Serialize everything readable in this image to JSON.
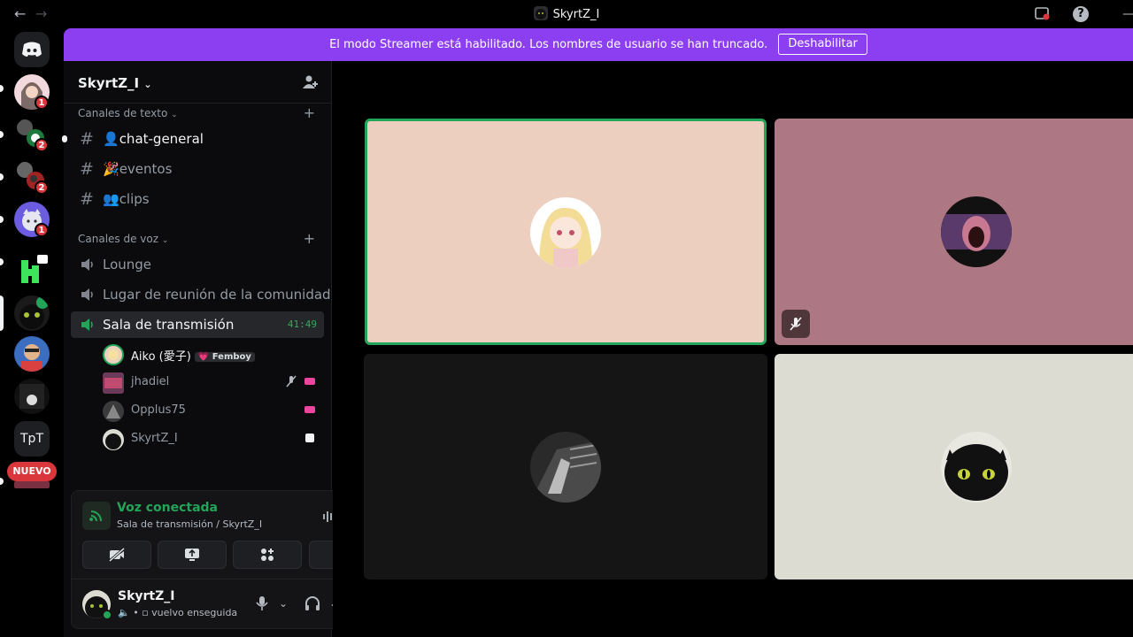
{
  "window": {
    "title": "SkyrtZ_I",
    "back_icon": "arrow-left-icon",
    "forward_icon": "arrow-right-icon",
    "help_label": "?"
  },
  "banner": {
    "text": "El modo Streamer está habilitado. Los nombres de usuario se han truncado.",
    "button_label": "Deshabilitar",
    "color": "#8c3ff0"
  },
  "guilds": {
    "items": [
      {
        "name": "discord-home",
        "badge": ""
      },
      {
        "name": "server-1",
        "badge": "1"
      },
      {
        "name": "server-2",
        "badge": "2"
      },
      {
        "name": "server-3",
        "badge": "2"
      },
      {
        "name": "server-4",
        "badge": "1"
      },
      {
        "name": "server-5",
        "badge": ""
      },
      {
        "name": "server-6",
        "badge": ""
      },
      {
        "name": "server-7",
        "badge": ""
      },
      {
        "name": "server-8",
        "badge": ""
      },
      {
        "name": "server-tpt",
        "label": "TpT"
      },
      {
        "name": "server-new",
        "label": "NUEVO"
      }
    ]
  },
  "server": {
    "name": "SkyrtZ_I",
    "text_category": "Canales de texto",
    "voice_category": "Canales de voz",
    "text_channels": [
      {
        "name": "chat-general",
        "emoji": "👤"
      },
      {
        "name": "eventos",
        "emoji": "🎉"
      },
      {
        "name": "clips",
        "emoji": "👥"
      }
    ],
    "voice_channels": [
      {
        "name": "Lounge"
      },
      {
        "name": "Lugar de reunión de la comunidad"
      },
      {
        "name": "Sala de transmisión",
        "timer": "41:49"
      }
    ],
    "members": [
      {
        "name": "Aiko (愛子)",
        "tag": "💗 Femboy"
      },
      {
        "name": "jhadiel"
      },
      {
        "name": "Opplus75"
      },
      {
        "name": "SkyrtZ_I"
      }
    ]
  },
  "voice_panel": {
    "title": "Voz conectada",
    "subtitle": "Sala de transmisión / SkyrtZ_I",
    "color": "#23a559"
  },
  "user_panel": {
    "name": "SkyrtZ_I",
    "status": "vuelvo enseguida"
  },
  "stage": {
    "tiles": [
      {
        "user": "Aiko",
        "bg": "#eccfbf",
        "speaking": true
      },
      {
        "user": "jhadiel",
        "bg": "#ad7884",
        "muted": true
      },
      {
        "user": "Opplus75",
        "bg": "#151516"
      },
      {
        "user": "SkyrtZ_I",
        "bg": "#dcdcd2"
      }
    ]
  }
}
